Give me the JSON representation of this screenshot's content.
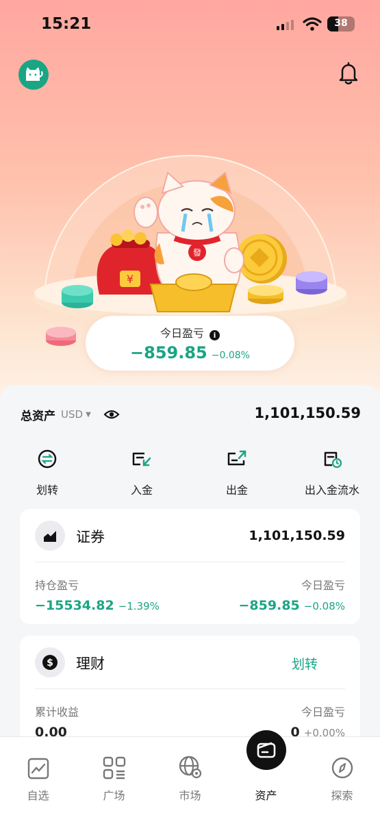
{
  "status_bar": {
    "time": "15:21",
    "battery": "38"
  },
  "hero": {
    "pnl_label": "今日盈亏",
    "pnl_value": "−859.85",
    "pnl_percent": "−0.08%",
    "mascot_badge": "發",
    "bag_symbol": "¥"
  },
  "summary": {
    "total_label": "总资产",
    "currency": "USD",
    "total_value": "1,101,150.59"
  },
  "actions": [
    {
      "label": "划转",
      "icon": "transfer-icon"
    },
    {
      "label": "入金",
      "icon": "deposit-icon"
    },
    {
      "label": "出金",
      "icon": "withdraw-icon"
    },
    {
      "label": "出入金流水",
      "icon": "history-icon"
    }
  ],
  "securities": {
    "title": "证券",
    "amount": "1,101,150.59",
    "position_pnl_label": "持仓盈亏",
    "position_pnl_value": "−15534.82",
    "position_pnl_percent": "−1.39%",
    "today_pnl_label": "今日盈亏",
    "today_pnl_value": "−859.85",
    "today_pnl_percent": "−0.08%"
  },
  "wealth": {
    "title": "理财",
    "link": "划转",
    "cum_label": "累计收益",
    "cum_value": "0.00",
    "today_label": "今日盈亏",
    "today_value": "0",
    "today_percent": "+0.00%"
  },
  "tabs": [
    {
      "label": "自选",
      "icon": "watchlist-icon"
    },
    {
      "label": "广场",
      "icon": "square-icon"
    },
    {
      "label": "市场",
      "icon": "market-globe-icon"
    },
    {
      "label": "资产",
      "icon": "wallet-icon",
      "active": true
    },
    {
      "label": "探索",
      "icon": "compass-icon"
    }
  ],
  "colors": {
    "accent": "#1aa584",
    "hero_top": "#ffa7a0",
    "hero_bottom": "#fdf1e6"
  }
}
